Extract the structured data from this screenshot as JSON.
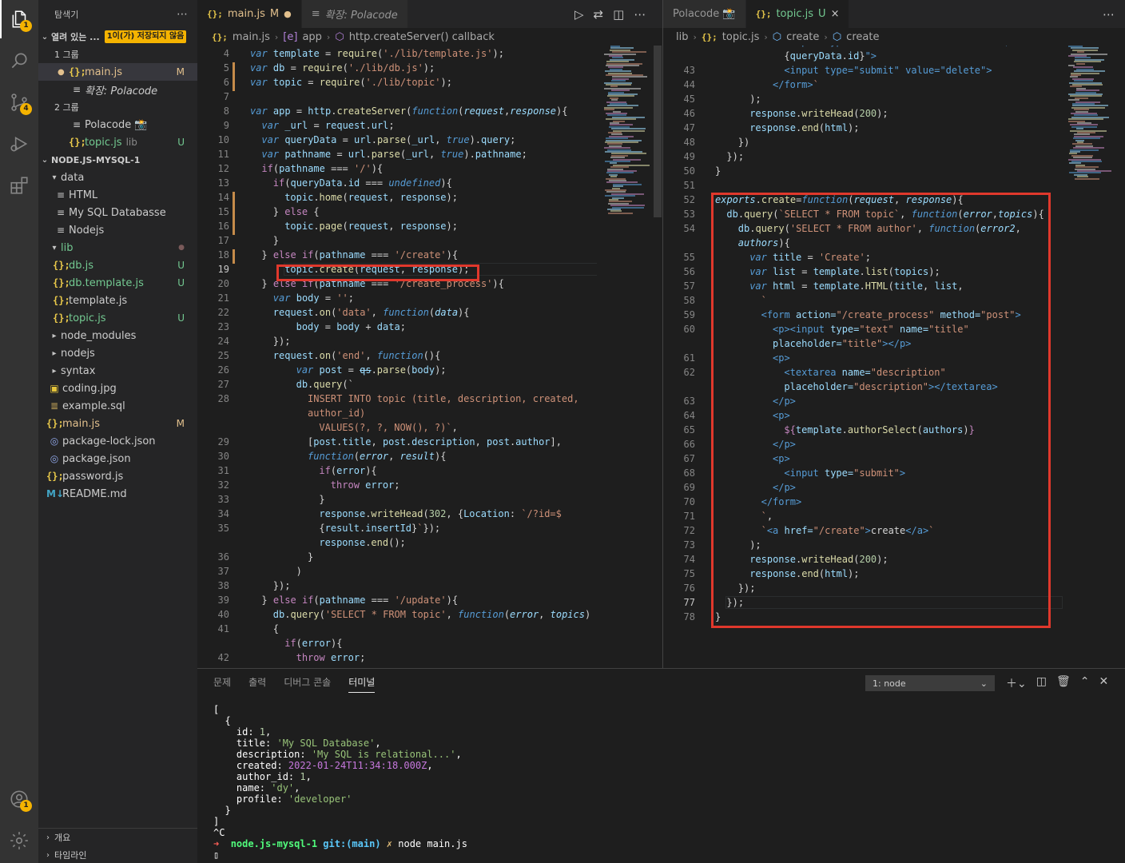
{
  "activity_bar": {
    "explorer_badge": "1",
    "scm_badge": "4",
    "account_badge": "1"
  },
  "explorer": {
    "title": "탐색기",
    "open_editors": {
      "label": "열려 있는 ...",
      "unsaved_badge": "1이(가) 저장되지 않음",
      "group1_label": "1 그룹",
      "group1_items": [
        {
          "name": "main.js",
          "status": "M"
        },
        {
          "name": "확장: Polacode",
          "status": ""
        }
      ],
      "group2_label": "2 그룹",
      "group2_items": [
        {
          "name": "Polacode 📸",
          "status": ""
        },
        {
          "name": "topic.js",
          "hint": "lib",
          "status": "U"
        }
      ]
    },
    "project": {
      "label": "NODE.JS-MYSQL-1",
      "items": [
        {
          "name": "data",
          "status": ""
        },
        {
          "name": "HTML",
          "status": ""
        },
        {
          "name": "My SQL Databasse",
          "status": ""
        },
        {
          "name": "Nodejs",
          "status": ""
        },
        {
          "name": "lib",
          "status": "●"
        },
        {
          "name": "db.js",
          "status": "U"
        },
        {
          "name": "db.template.js",
          "status": "U"
        },
        {
          "name": "template.js",
          "status": ""
        },
        {
          "name": "topic.js",
          "status": "U"
        },
        {
          "name": "node_modules",
          "status": ""
        },
        {
          "name": "nodejs",
          "status": ""
        },
        {
          "name": "syntax",
          "status": ""
        },
        {
          "name": "coding.jpg",
          "status": ""
        },
        {
          "name": "example.sql",
          "status": ""
        },
        {
          "name": "main.js",
          "status": "M"
        },
        {
          "name": "package-lock.json",
          "status": ""
        },
        {
          "name": "package.json",
          "status": ""
        },
        {
          "name": "password.js",
          "status": ""
        },
        {
          "name": "README.md",
          "status": ""
        }
      ]
    },
    "outline_label": "개요",
    "timeline_label": "타임라인"
  },
  "editor_left": {
    "tabs": [
      {
        "label": "main.js",
        "status": "M"
      },
      {
        "label": "확장: Polacode"
      }
    ],
    "breadcrumb": [
      "main.js",
      "app",
      "http.createServer() callback"
    ]
  },
  "editor_right": {
    "tabs": [
      {
        "label": "Polacode 📸"
      },
      {
        "label": "topic.js",
        "status": "U"
      }
    ],
    "breadcrumb": [
      "lib",
      "topic.js",
      "create",
      "create"
    ]
  },
  "panel": {
    "tabs": [
      "문제",
      "출력",
      "디버그 콘솔",
      "터미널"
    ],
    "active_tab": "터미널",
    "terminal_select": "1: node",
    "terminal": {
      "line_open": "[",
      "obj_open": "  {",
      "id_key": "    id: ",
      "id_val": "1",
      "title_key": "    title: ",
      "title_val": "'My SQL Database'",
      "desc_key": "    description: ",
      "desc_val": "'My SQL is relational...'",
      "created_key": "    created: ",
      "created_val": "2022-01-24T11:34:18.000Z",
      "author_key": "    author_id: ",
      "author_val": "1",
      "name_key": "    name: ",
      "name_val": "'dy'",
      "profile_key": "    profile: ",
      "profile_val": "'developer'",
      "obj_close": "  }",
      "line_close": "]",
      "ctrl_c": "^C",
      "prompt_arrow": "➜",
      "prompt_dir": "node.js-mysql-1",
      "prompt_git": "git:(main)",
      "prompt_x": "✗",
      "prompt_cmd": "node main.js"
    }
  },
  "colors": {
    "accent_red": "#e0382c",
    "badge_yellow": "#f5b300",
    "modified": "#e2c08d",
    "untracked": "#73c991"
  }
}
